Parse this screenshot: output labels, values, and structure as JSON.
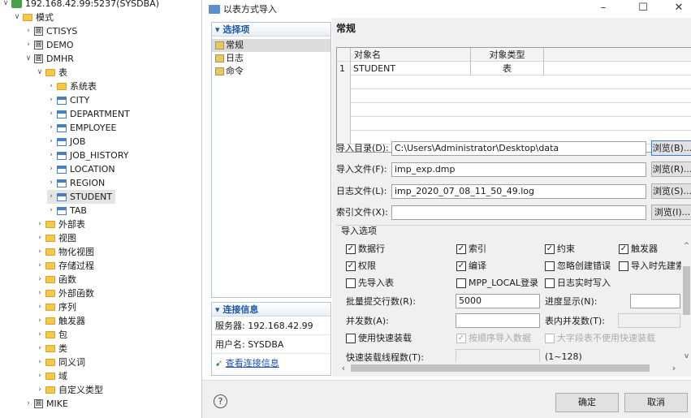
{
  "tree": {
    "server": "192.168.42.99:5237(SYSDBA)",
    "schemas_label": "模式",
    "schemas": [
      "CTISYS",
      "DEMO",
      "DMHR"
    ],
    "table_folder": "表",
    "system_tables": "系统表",
    "tables": [
      "CITY",
      "DEPARTMENT",
      "EMPLOYEE",
      "JOB",
      "JOB_HISTORY",
      "LOCATION",
      "REGION",
      "STUDENT",
      "TAB"
    ],
    "folders": [
      "外部表",
      "视图",
      "物化视图",
      "存储过程",
      "函数",
      "外部函数",
      "序列",
      "触发器",
      "包",
      "类",
      "同义词",
      "域",
      "自定义类型"
    ],
    "last_schema": "MIKE"
  },
  "dialog": {
    "title": "以表方式导入",
    "min": "–",
    "max": "☐",
    "close": "✕",
    "options_header": "选择项",
    "options": [
      "常规",
      "日志",
      "命令"
    ],
    "conn_header": "连接信息",
    "server_text": "服务器: 192.168.42.99",
    "user_text": "用户名: SYSDBA",
    "conn_link": "查看连接信息",
    "section_title": "常规",
    "grid": {
      "headers": [
        "对象名",
        "对象类型"
      ],
      "rows": [
        {
          "num": "1",
          "name": "STUDENT",
          "type": "表"
        }
      ]
    },
    "import_dir_label": "导入目录(D):",
    "import_dir_value": "C:\\Users\\Administrator\\Desktop\\data",
    "browse_b": "浏览(B)...",
    "import_file_label": "导入文件(F):",
    "import_file_value": "imp_exp.dmp",
    "browse_r": "浏览(R)...",
    "log_file_label": "日志文件(L):",
    "log_file_value": "imp_2020_07_08_11_50_49.log",
    "browse_s": "浏览(S)...",
    "index_file_label": "索引文件(X):",
    "index_file_value": "",
    "browse_i": "浏览(I)...",
    "import_options_label": "导入选项",
    "cb_rows": "数据行",
    "cb_index": "索引",
    "cb_constraint": "约束",
    "cb_trigger": "触发器",
    "cb_privilege": "权限",
    "cb_compile": "编译",
    "cb_ignore_err": "忽略创建错误",
    "cb_import_first": "导入时先建索",
    "cb_first_table": "先导入表",
    "cb_mpp": "MPP_LOCAL登录",
    "cb_log_realtime": "日志实时写入",
    "batch_label": "批量提交行数(R):",
    "batch_value": "5000",
    "progress_label": "进度显示(N):",
    "parallel_label": "并发数(A):",
    "table_parallel_label": "表内并发数(T):",
    "cb_fast_load": "使用快速装载",
    "cb_seq_import": "按顺序导入数据",
    "cb_big_field": "大字段表不使用快速装载",
    "fast_threads_label": "快速装载线程数(T):",
    "range_hint": "(1~128)",
    "help": "?",
    "ok": "确定",
    "cancel": "取消"
  }
}
